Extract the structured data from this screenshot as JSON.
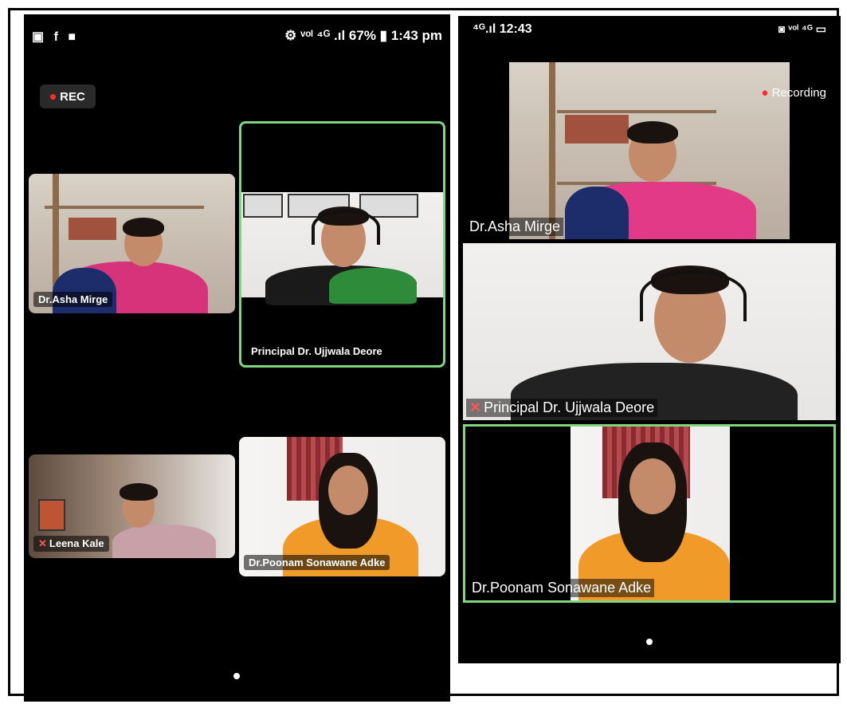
{
  "left": {
    "status_icons": "▣ f ■",
    "status_right": "⚙ ᵛᵒˡ ⁴ᴳ .ıl 67% ▮ 1:43 pm",
    "rec_label": "REC",
    "tiles": [
      {
        "name": "Dr.Asha Mirge"
      },
      {
        "name": "Principal  Dr. Ujjwala Deore",
        "active": true
      },
      {
        "name": "Leena Kale",
        "muted": true
      },
      {
        "name": "Dr.Poonam Sonawane Adke"
      }
    ]
  },
  "right": {
    "status_left": "⁴ᴳ.ıl 12:43",
    "status_right": "◙ ᵛᵒˡ ⁴ᴳ ▭",
    "recording_label": "Recording",
    "tiles": [
      {
        "name": "Dr.Asha Mirge"
      },
      {
        "name": "Principal  Dr. Ujjwala Deore",
        "muted": true
      },
      {
        "name": "Dr.Poonam Sonawane Adke",
        "active": true
      }
    ]
  },
  "colors": {
    "active_border": "#7fd67f",
    "rec_dot": "#ff2a2a",
    "mic_off": "#ff5555"
  }
}
